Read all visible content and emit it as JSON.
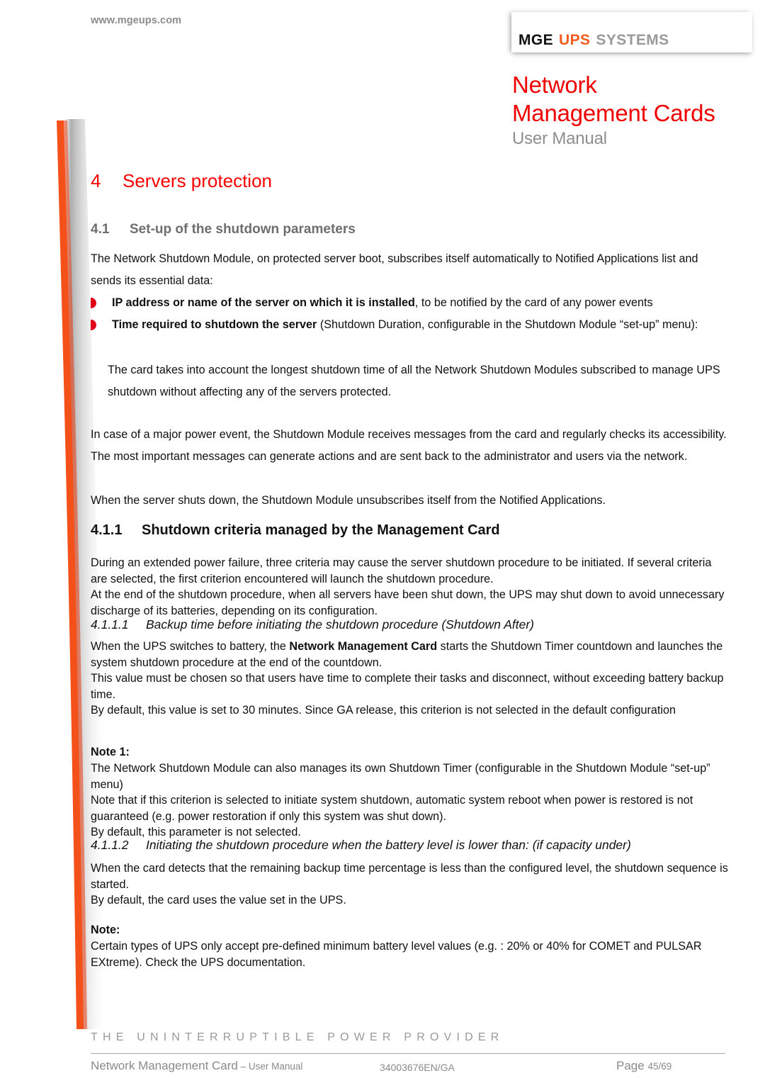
{
  "header": {
    "site_url": "www.mgeups.com",
    "logo": {
      "part1": "MGE",
      "part2": "UPS",
      "part3": "SYSTEMS",
      "color_part1": "#111111",
      "color_part2": "#F25C1E",
      "color_part3": "#9a9a9a"
    },
    "doc_title_line1": "Network",
    "doc_title_line2": "Management Cards",
    "doc_subtitle": "User Manual",
    "title_color": "#F00000",
    "subtitle_color": "#8e8e8e"
  },
  "headings": {
    "h1_num": "4",
    "h1_text": "Servers protection",
    "h2_num": "4.1",
    "h2_text": "Set-up of the shutdown parameters",
    "h3_num": "4.1.1",
    "h3_text": "Shutdown criteria managed by the Management Card",
    "h4a_num": "4.1.1.1",
    "h4a_text": "Backup time before initiating the shutdown procedure  (Shutdown After)",
    "h4b_num": "4.1.1.2",
    "h4b_text": "Initiating the shutdown procedure when the battery level is lower than: (if capacity under)"
  },
  "body": {
    "intro": "The Network Shutdown Module, on protected server boot, subscribes itself automatically to Notified Applications list and sends its essential data:",
    "bullets": [
      {
        "bold": "IP address or name of the server on which it is installed",
        "rest": ", to be notified by the card of any power events"
      },
      {
        "bold": "Time required to shutdown the server",
        "rest": " (Shutdown Duration, configurable in the Shutdown Module “set-up” menu):"
      }
    ],
    "sub_para": "The card takes into account the longest shutdown time of all the Network Shutdown Modules subscribed to manage UPS shutdown without affecting any of the servers protected.",
    "para_major_event": "In case of a major power event, the Shutdown Module receives messages from the card and regularly checks its accessibility. The most important messages can generate actions and are sent back to the administrator and users via the network.",
    "para_unsubscribe": "When the server shuts down, the Shutdown Module unsubscribes itself from the Notified Applications.",
    "para_criteria": "During an extended power failure, three criteria may cause the server shutdown procedure to be initiated. If several criteria are selected, the first criterion encountered will launch the shutdown procedure.\nAt the end of the shutdown procedure, when all servers have been shut down, the UPS may shut down to avoid unnecessary discharge of its batteries, depending on its configuration.",
    "para_shutdown_after_1_pre": "When the UPS switches to battery, the ",
    "para_shutdown_after_1_bold": "Network Management Card",
    "para_shutdown_after_1_post": " starts the Shutdown Timer countdown and launches the system shutdown procedure at the end of the countdown.",
    "para_shutdown_after_2": "This value must be chosen so that users have time to complete their tasks and disconnect, without exceeding battery backup time.",
    "para_shutdown_after_3": "By default, this value is set to 30 minutes. Since GA release, this criterion is not selected in the default configuration",
    "note1_label": "Note 1:",
    "note1_text": "The Network Shutdown Module can also manages its own Shutdown Timer  (configurable in the Shutdown Module “set-up” menu)\nNote that if this criterion is selected to initiate system shutdown, automatic system reboot when power is restored is not guaranteed (e.g. power restoration if only this system was shut down).\nBy default, this parameter is not selected.",
    "para_capacity_under": "When the card detects that the remaining backup time percentage is less than the configured level, the shutdown sequence is started.\nBy default, the card uses the value set in the UPS.",
    "note2_label": "Note:",
    "note2_text": "Certain types of UPS only accept pre-defined minimum battery level values (e.g. : 20% or 40% for COMET and PULSAR EXtreme). Check the UPS documentation."
  },
  "footer": {
    "tagline": "THE UNINTERRUPTIBLE POWER PROVIDER",
    "doc_name": "Network Management Card",
    "doc_kind": " – User Manual",
    "doc_ref": "34003676EN/GA",
    "page_label": "Page ",
    "page_number": "45/69"
  },
  "decoration": {
    "swoosh_color": "#F4511A",
    "swoosh_shadow": "#b9b9b9",
    "bullet_color": "#E00018"
  }
}
